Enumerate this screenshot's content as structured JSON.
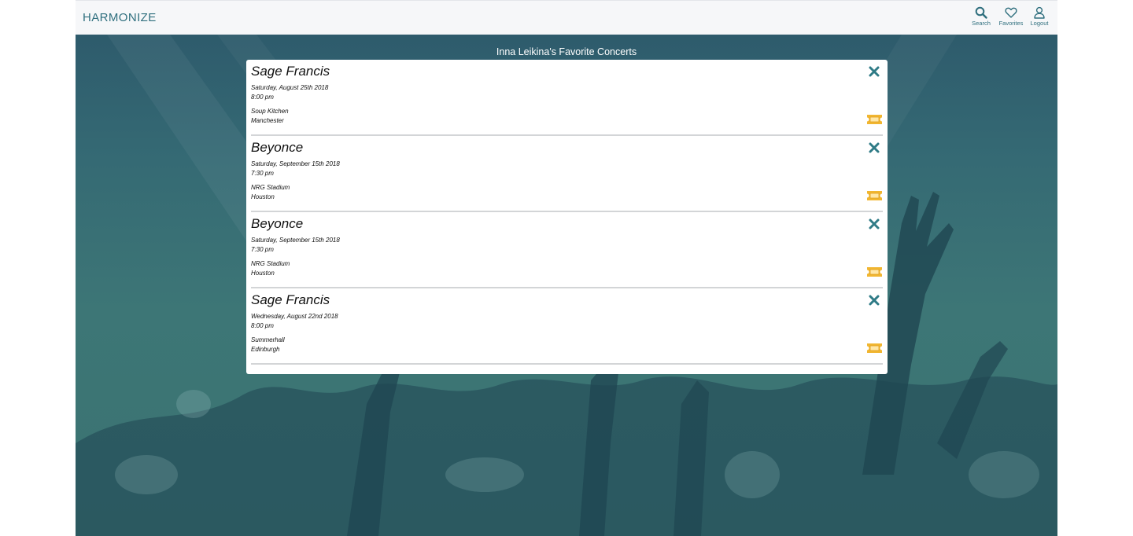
{
  "navbar": {
    "brand": "HARMONIZE",
    "items": [
      {
        "label": "Search",
        "icon": "search-icon"
      },
      {
        "label": "Favorites",
        "icon": "heart-icon"
      },
      {
        "label": "Logout",
        "icon": "user-icon"
      }
    ]
  },
  "page": {
    "title": "Inna Leikina's Favorite Concerts"
  },
  "concerts": [
    {
      "artist": "Sage Francis",
      "date": "Saturday, August 25th 2018",
      "time": "8:00 pm",
      "venue": "Soup Kitchen",
      "city": "Manchester"
    },
    {
      "artist": "Beyonce",
      "date": "Saturday, September 15th 2018",
      "time": "7:30 pm",
      "venue": "NRG Stadium",
      "city": "Houston"
    },
    {
      "artist": "Beyonce",
      "date": "Saturday, September 15th 2018",
      "time": "7:30 pm",
      "venue": "NRG Stadium",
      "city": "Houston"
    },
    {
      "artist": "Sage Francis",
      "date": "Wednesday, August 22nd 2018",
      "time": "8:00 pm",
      "venue": "Summerhall",
      "city": "Edinburgh"
    }
  ],
  "colors": {
    "accent": "#2f6f7e",
    "remove": "#2f7b86",
    "ticket": "#f1b631",
    "hero_background": "#3a7371"
  }
}
